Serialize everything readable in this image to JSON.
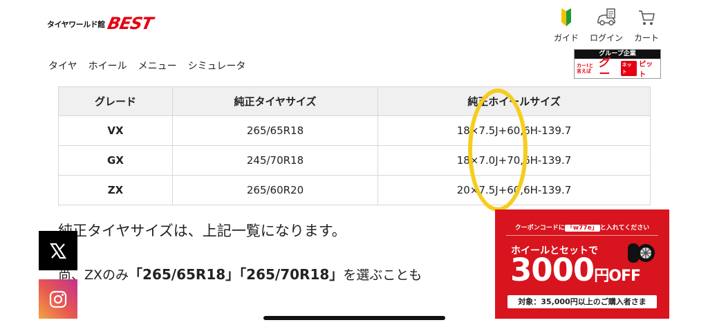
{
  "header": {
    "logo_small": "タイヤワールド館",
    "logo_main": "BEST",
    "icons": [
      {
        "icon": "beginner-mark-icon",
        "label": "ガイド"
      },
      {
        "icon": "login-icon",
        "label": "ログイン"
      },
      {
        "icon": "cart-icon",
        "label": "カート"
      }
    ]
  },
  "nav": {
    "items": [
      "タイヤ",
      "ホイール",
      "メニュー",
      "シミュレータ"
    ]
  },
  "group_banner": {
    "header": "グループ企業",
    "small_text": "カー!と言えば",
    "goo": "グー",
    "net": "ネット",
    "pit": "ピット"
  },
  "table": {
    "headers": [
      "グレード",
      "純正タイヤサイズ",
      "純正ホイールサイズ"
    ],
    "rows": [
      {
        "grade": "VX",
        "tire": "265/65R18",
        "wheel": "18×7.5J+60,6H-139.7"
      },
      {
        "grade": "GX",
        "tire": "245/70R18",
        "wheel": "18×7.0J+70,6H-139.7"
      },
      {
        "grade": "ZX",
        "tire": "265/60R20",
        "wheel": "20×7.5J+60,6H-139.7"
      }
    ]
  },
  "content": {
    "para1": "純正タイヤサイズは、上記一覧になります。",
    "para2_prefix": "尚、ZXのみ",
    "para2_bold1": "「265/65R18」",
    "para2_bold2": "「265/70R18」",
    "para2_suffix": "を選ぶことも"
  },
  "share": {
    "x_icon": "x-logo-icon",
    "instagram_icon": "instagram-icon"
  },
  "coupon": {
    "top_prefix": "クーポンコードに",
    "code": "「w77e」",
    "top_suffix": "と入れてください",
    "set_text": "ホイールとセットで",
    "amount": "3000",
    "amount_unit": "円OFF",
    "condition": "対象：35,000円以上のご購入者さま"
  },
  "colors": {
    "brand_red": "#e60012",
    "coupon_red": "#d8141e",
    "highlight_yellow": "#f6cd1e",
    "header_gray": "#f0f0f0"
  }
}
